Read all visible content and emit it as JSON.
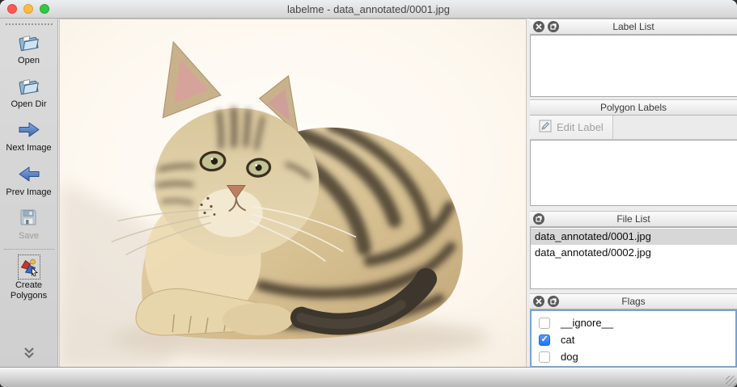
{
  "window": {
    "title": "labelme - data_annotated/0001.jpg"
  },
  "toolbar": {
    "items": [
      {
        "label": "Open",
        "icon": "open-folder-icon",
        "enabled": true,
        "active": false
      },
      {
        "label": "Open Dir",
        "icon": "open-dir-folder-icon",
        "enabled": true,
        "active": false
      },
      {
        "label": "Next Image",
        "icon": "arrow-right-icon",
        "enabled": true,
        "active": false
      },
      {
        "label": "Prev Image",
        "icon": "arrow-left-icon",
        "enabled": true,
        "active": false
      },
      {
        "label": "Save",
        "icon": "floppy-disk-icon",
        "enabled": false,
        "active": false
      },
      {
        "label": "Create Polygons",
        "icon": "create-polygons-icon",
        "enabled": true,
        "active": true
      }
    ],
    "overflow_icon": "chevron-double-down-icon"
  },
  "panels": {
    "label_list": {
      "title": "Label List",
      "items": []
    },
    "polygon_labels": {
      "title": "Polygon Labels",
      "edit_button_label": "Edit Label",
      "edit_button_enabled": false,
      "items": []
    },
    "file_list": {
      "title": "File List",
      "items": [
        {
          "name": "data_annotated/0001.jpg",
          "selected": true
        },
        {
          "name": "data_annotated/0002.jpg",
          "selected": false
        }
      ]
    },
    "flags": {
      "title": "Flags",
      "focused": true,
      "items": [
        {
          "label": "__ignore__",
          "checked": false
        },
        {
          "label": "cat",
          "checked": true
        },
        {
          "label": "dog",
          "checked": false
        }
      ]
    }
  },
  "statusbar": {
    "text": ""
  },
  "canvas": {
    "image_description": "tabby kitten lying on cream background"
  },
  "colors": {
    "traffic_red": "#fc5753",
    "traffic_yellow": "#fdbc40",
    "traffic_green": "#33c748",
    "checkbox_checked": "#2176f5",
    "flags_focus_border": "#76a3d4",
    "selected_row": "#d7d7d7",
    "window_chrome": "#ececec"
  }
}
